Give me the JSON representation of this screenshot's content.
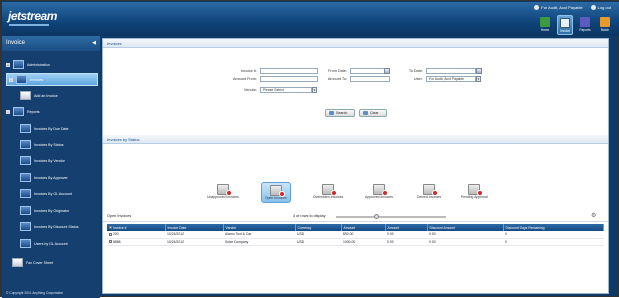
{
  "app": {
    "logo": "jetstream",
    "user": "For Audit, Acct Payable",
    "logout": "Log out"
  },
  "topnav": [
    {
      "label": "Home",
      "color": "#3f9a3f"
    },
    {
      "label": "Invoice",
      "color": "#2d6ba8"
    },
    {
      "label": "Reports",
      "color": "#5b5bc0"
    },
    {
      "label": "Batch",
      "color": "#e89a2b"
    }
  ],
  "sidebar": {
    "title": "Invoice",
    "items": [
      "Administration",
      "Invoices",
      "Add an Invoice",
      "Reports",
      "Invoices By Due Date",
      "Invoices By Status",
      "Invoices By Vendor",
      "Invoices By Approver",
      "Invoices By GL Account",
      "Invoices By Originator",
      "Invoices By Discount Status",
      "Users by GL Account",
      "Fax Cover Sheet"
    ],
    "copyright": "© Copyright 2011 Anything Corporation"
  },
  "search": {
    "title": "Invoices",
    "invoice_no_label": "Invoice #:",
    "amount_from_label": "Amount From:",
    "vendor_label": "Vendor:",
    "vendor_value": "Please Select",
    "from_date_label": "From Date:",
    "amount_to_label": "Amount To:",
    "to_date_label": "To Date:",
    "user_label": "User:",
    "user_value": "For Audit, Acct Payable",
    "search_btn": "Search",
    "clear_btn": "Clear"
  },
  "status": {
    "title": "Invoices by Status",
    "items": [
      "Unapproved Invoices",
      "Open Invoices",
      "Overridden Invoices",
      "Approved Invoices",
      "Denied Invoices",
      "Pending Approval"
    ]
  },
  "open_invoices": {
    "title": "Open Invoices",
    "count_text": "4 of rows to display"
  },
  "table": {
    "columns": [
      "Invoice #",
      "Invoice Date",
      "Vendor",
      "Currency",
      "Amount",
      "Amount",
      "Discount Amount",
      "Discount Days Remaining"
    ],
    "rows": [
      [
        "200",
        "10/24/2012",
        "Alamo Tool & Car",
        "USD",
        "$90.00",
        "0.00",
        "0.00",
        "0"
      ],
      [
        "8888",
        "10/24/2012",
        "Solar Company",
        "USD",
        "1000.00",
        "0.00",
        "0.00",
        "0"
      ]
    ]
  }
}
